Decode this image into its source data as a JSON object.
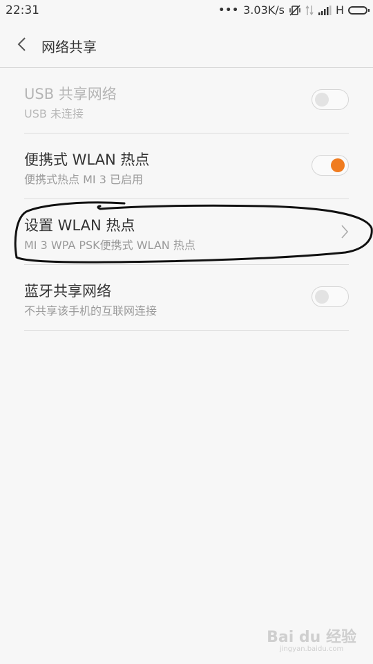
{
  "status_bar": {
    "time": "22:31",
    "dots": "•••",
    "speed": "3.03K/s",
    "network": "H"
  },
  "header": {
    "title": "网络共享"
  },
  "items": [
    {
      "title": "USB 共享网络",
      "subtitle": "USB 未连接",
      "toggle": "off",
      "enabled": false
    },
    {
      "title": "便携式 WLAN 热点",
      "subtitle": "便携式热点 MI 3 已启用",
      "toggle": "on",
      "enabled": true
    },
    {
      "title": "设置 WLAN 热点",
      "subtitle": "MI 3 WPA PSK便携式 WLAN 热点",
      "enabled": true
    },
    {
      "title": "蓝牙共享网络",
      "subtitle": "不共享该手机的互联网连接",
      "toggle": "off",
      "enabled": true
    }
  ],
  "watermark": {
    "main": "Bai du 经验",
    "sub": "jingyan.baidu.com"
  },
  "colors": {
    "accent": "#f07c20",
    "background": "#f7f7f7"
  }
}
